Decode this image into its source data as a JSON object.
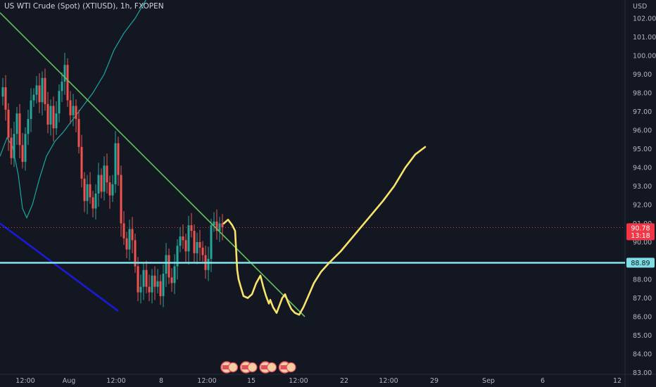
{
  "header": {
    "title": "US WTI Crude (Spot) (XTIUSD), 1h, FXOPEN"
  },
  "colors": {
    "background": "#131722",
    "candle_up": "#26a69a",
    "candle_down": "#ef5350",
    "ma_line": "#1aa6a0",
    "trendline": "#5fc25c",
    "channel_line": "#1a1ad8",
    "support_line": "#7fdde6",
    "projection": "#f9e46b",
    "price_tag": "#f23645"
  },
  "chart_data": {
    "type": "candlestick",
    "currency_label": "USD",
    "ylim": [
      82.0,
      103.0
    ],
    "y_ticks": [
      "102.00",
      "101.00",
      "100.00",
      "99.00",
      "98.00",
      "97.00",
      "96.00",
      "95.00",
      "94.00",
      "93.00",
      "92.00",
      "91.00",
      "90.00",
      "88.00",
      "87.00",
      "86.00",
      "85.00",
      "84.00",
      "83.00"
    ],
    "x_ticks": [
      "12:00",
      "Aug",
      "12:00",
      "8",
      "12:00",
      "15",
      "12:00",
      "22",
      "12:00",
      "29",
      "Sep",
      "6",
      "12"
    ],
    "current_price": {
      "value": 90.78,
      "label": "90.78",
      "countdown": "13:18"
    },
    "support_level": {
      "value": 88.89,
      "label": "88.89"
    },
    "event_markers": 4,
    "price_series": [
      [
        0,
        97.8
      ],
      [
        4,
        98.3
      ],
      [
        8,
        97.1
      ],
      [
        12,
        95.6
      ],
      [
        16,
        94.5
      ],
      [
        20,
        95.8
      ],
      [
        24,
        96.9
      ],
      [
        28,
        95.2
      ],
      [
        32,
        94.3
      ],
      [
        36,
        95.8
      ],
      [
        40,
        96.6
      ],
      [
        44,
        97.6
      ],
      [
        48,
        97.9
      ],
      [
        52,
        98.4
      ],
      [
        56,
        97.5
      ],
      [
        60,
        98.8
      ],
      [
        64,
        97.4
      ],
      [
        68,
        96.3
      ],
      [
        72,
        97.3
      ],
      [
        76,
        96.1
      ],
      [
        80,
        96.9
      ],
      [
        84,
        98.1
      ],
      [
        88,
        98.6
      ],
      [
        92,
        99.5
      ],
      [
        96,
        97.6
      ],
      [
        100,
        96.8
      ],
      [
        104,
        97.3
      ],
      [
        108,
        96.6
      ],
      [
        112,
        95.1
      ],
      [
        116,
        93.4
      ],
      [
        120,
        92.2
      ],
      [
        124,
        93.1
      ],
      [
        128,
        92.4
      ],
      [
        132,
        91.8
      ],
      [
        136,
        92.6
      ],
      [
        140,
        93.6
      ],
      [
        144,
        92.7
      ],
      [
        148,
        94.1
      ],
      [
        152,
        93.2
      ],
      [
        156,
        92.5
      ],
      [
        160,
        93.1
      ],
      [
        164,
        95.3
      ],
      [
        168,
        93.6
      ],
      [
        172,
        91.0
      ],
      [
        176,
        90.2
      ],
      [
        180,
        89.6
      ],
      [
        184,
        90.7
      ],
      [
        188,
        90.1
      ],
      [
        192,
        88.7
      ],
      [
        196,
        87.3
      ],
      [
        200,
        87.6
      ],
      [
        204,
        88.5
      ],
      [
        208,
        87.6
      ],
      [
        212,
        87.3
      ],
      [
        216,
        88.2
      ],
      [
        220,
        87.6
      ],
      [
        224,
        87.9
      ],
      [
        228,
        87.1
      ],
      [
        232,
        88.3
      ],
      [
        236,
        89.3
      ],
      [
        240,
        88.1
      ],
      [
        244,
        87.8
      ],
      [
        248,
        88.7
      ],
      [
        252,
        89.8
      ],
      [
        256,
        90.3
      ],
      [
        260,
        90.1
      ],
      [
        264,
        89.5
      ],
      [
        268,
        90.9
      ],
      [
        272,
        90.6
      ],
      [
        276,
        89.4
      ],
      [
        280,
        90.0
      ],
      [
        284,
        89.7
      ],
      [
        288,
        89.3
      ],
      [
        292,
        88.5
      ],
      [
        296,
        89.1
      ],
      [
        300,
        90.9
      ],
      [
        304,
        91.1
      ],
      [
        308,
        90.6
      ],
      [
        312,
        91.0
      ],
      [
        316,
        90.8
      ]
    ],
    "ma_series": [
      [
        0,
        94.6
      ],
      [
        10,
        95.6
      ],
      [
        18,
        95.1
      ],
      [
        26,
        93.6
      ],
      [
        32,
        91.8
      ],
      [
        38,
        91.3
      ],
      [
        46,
        92.0
      ],
      [
        56,
        93.4
      ],
      [
        66,
        94.6
      ],
      [
        78,
        95.4
      ],
      [
        90,
        95.9
      ],
      [
        104,
        96.6
      ],
      [
        118,
        97.3
      ],
      [
        132,
        98.0
      ],
      [
        148,
        99.0
      ],
      [
        162,
        100.3
      ],
      [
        176,
        101.2
      ],
      [
        192,
        102.0
      ],
      [
        206,
        102.9
      ],
      [
        220,
        103.8
      ]
    ],
    "trendline": [
      [
        0,
        102.3
      ],
      [
        433,
        86.0
      ]
    ],
    "channel_line": [
      [
        0,
        91.0
      ],
      [
        168,
        86.3
      ]
    ],
    "projection": [
      [
        318,
        91.0
      ],
      [
        324,
        91.2
      ],
      [
        330,
        90.9
      ],
      [
        334,
        90.6
      ],
      [
        337,
        88.5
      ],
      [
        339,
        88.0
      ],
      [
        342,
        87.6
      ],
      [
        346,
        87.1
      ],
      [
        352,
        87.0
      ],
      [
        358,
        87.2
      ],
      [
        364,
        87.8
      ],
      [
        370,
        88.2
      ],
      [
        374,
        87.6
      ],
      [
        378,
        87.1
      ],
      [
        382,
        86.7
      ],
      [
        384,
        86.9
      ],
      [
        388,
        86.5
      ],
      [
        393,
        86.2
      ],
      [
        397,
        86.6
      ],
      [
        401,
        87.0
      ],
      [
        405,
        87.2
      ],
      [
        409,
        86.8
      ],
      [
        414,
        86.4
      ],
      [
        419,
        86.2
      ],
      [
        425,
        86.1
      ],
      [
        431,
        86.5
      ],
      [
        438,
        87.1
      ],
      [
        446,
        87.8
      ],
      [
        456,
        88.4
      ],
      [
        468,
        88.9
      ],
      [
        484,
        89.5
      ],
      [
        504,
        90.4
      ],
      [
        524,
        91.3
      ],
      [
        544,
        92.2
      ],
      [
        560,
        93.0
      ],
      [
        576,
        94.0
      ],
      [
        590,
        94.7
      ],
      [
        604,
        95.1
      ]
    ]
  }
}
